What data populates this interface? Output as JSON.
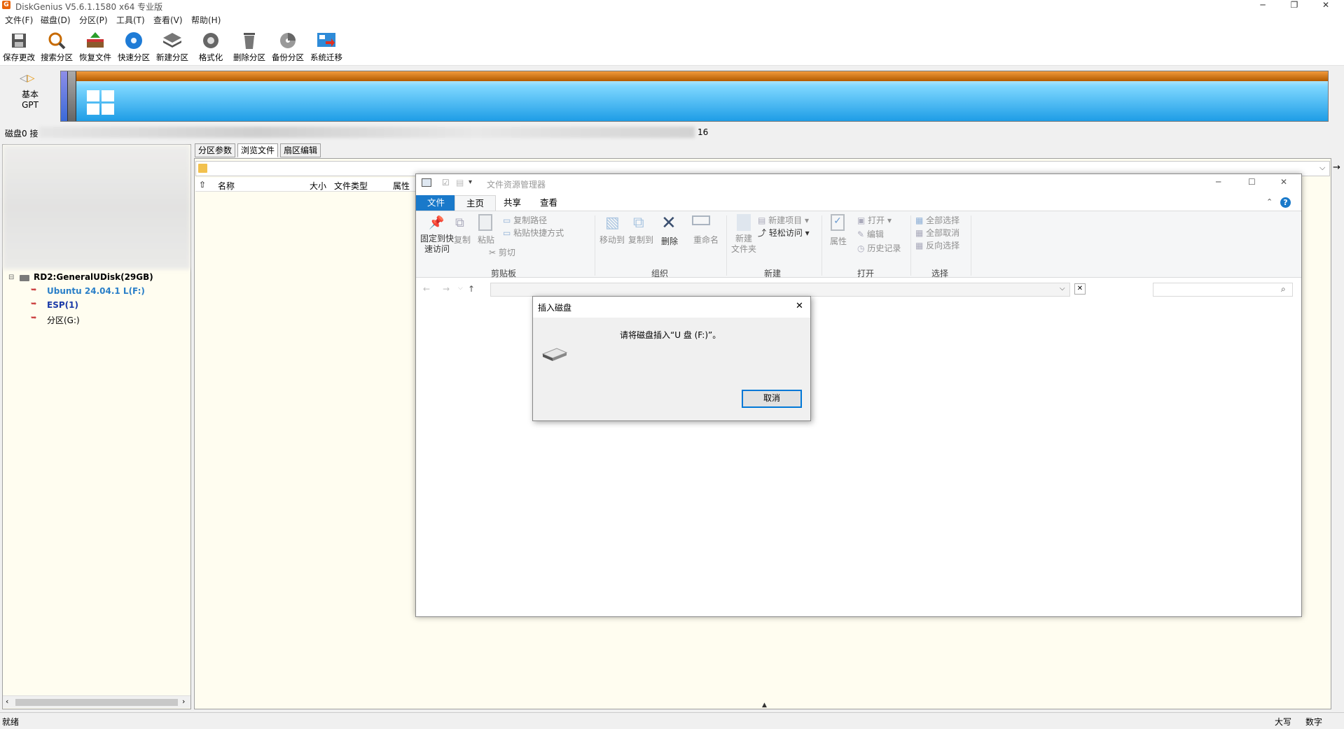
{
  "app": {
    "title": "DiskGenius V5.6.1.1580 x64 专业版",
    "icon_letter": "G"
  },
  "menu": [
    "文件(F)",
    "磁盘(D)",
    "分区(P)",
    "工具(T)",
    "查看(V)",
    "帮助(H)"
  ],
  "toolbar": [
    "保存更改",
    "搜索分区",
    "恢复文件",
    "快速分区",
    "新建分区",
    "格式化",
    "删除分区",
    "备份分区",
    "系统迁移"
  ],
  "disk_nav": {
    "type_line1": "基本",
    "type_line2": "GPT"
  },
  "disk_info": {
    "prefix": "磁盘0 接",
    "suffix": "16"
  },
  "tree": {
    "disk": "RD2:GeneralUDisk(29GB)",
    "partitions": [
      "Ubuntu 24.04.1 L(F:)",
      "ESP(1)",
      "分区(G:)"
    ]
  },
  "tabs": [
    "分区参数",
    "浏览文件",
    "扇区编辑"
  ],
  "columns": [
    "名称",
    "大小",
    "文件类型",
    "属性"
  ],
  "status": {
    "left": "就绪",
    "caps": "大写",
    "num": "数字"
  },
  "explorer": {
    "title": "文件资源管理器",
    "tabs": [
      "文件",
      "主页",
      "共享",
      "查看"
    ],
    "ribbon": {
      "pin": [
        "固定到快",
        "速访问"
      ],
      "copy": "复制",
      "paste": "粘贴",
      "copy_path": "复制路径",
      "paste_shortcut": "粘贴快捷方式",
      "cut": "剪切",
      "move_to": "移动到",
      "copy_to": "复制到",
      "delete": "删除",
      "rename": "重命名",
      "new_folder": [
        "新建",
        "文件夹"
      ],
      "new_item": "新建项目",
      "easy_access": "轻松访问",
      "properties": "属性",
      "open": "打开",
      "edit": "编辑",
      "history": "历史记录",
      "select_all": "全部选择",
      "select_none": "全部取消",
      "invert": "反向选择",
      "groups": [
        "剪贴板",
        "组织",
        "新建",
        "打开",
        "选择"
      ]
    }
  },
  "dialog": {
    "title": "插入磁盘",
    "message": "请将磁盘插入“U 盘 (F:)”。",
    "cancel": "取消"
  },
  "colors": {
    "accent": "#1979ca",
    "tree_bg": "#fffdf0",
    "disk_orange": "#c46a10",
    "disk_blue": "#1e9de6"
  }
}
